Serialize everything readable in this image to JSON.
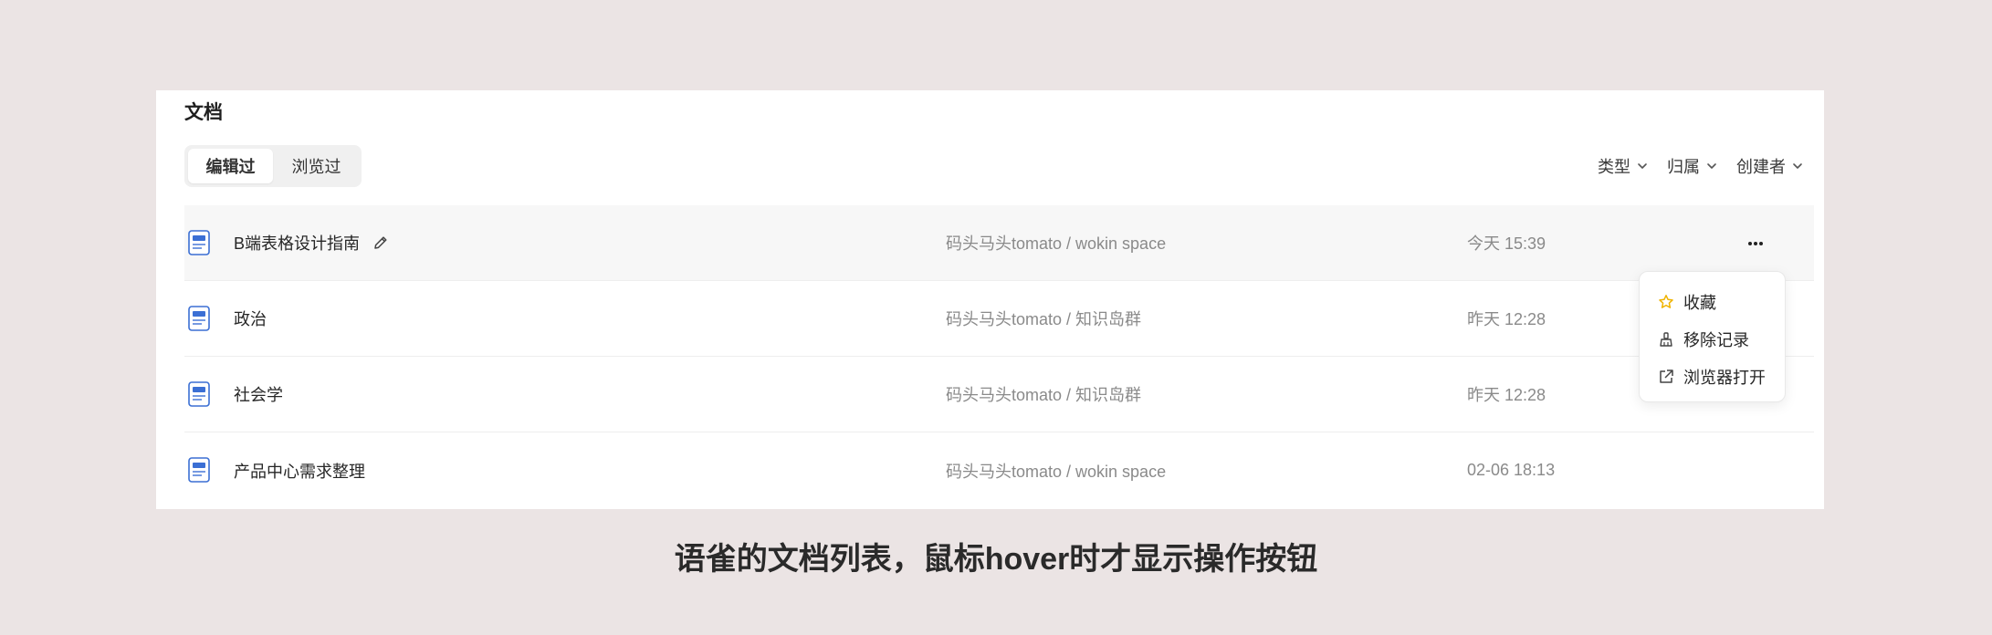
{
  "panel": {
    "title": "文档",
    "tabs": [
      {
        "label": "编辑过",
        "active": true
      },
      {
        "label": "浏览过",
        "active": false
      }
    ],
    "filters": [
      {
        "label": "类型"
      },
      {
        "label": "归属"
      },
      {
        "label": "创建者"
      }
    ]
  },
  "documents": [
    {
      "name": "B端表格设计指南",
      "belong": "码头马头tomato / wokin space",
      "time": "今天 15:39",
      "hovered": true
    },
    {
      "name": "政治",
      "belong": "码头马头tomato / 知识岛群",
      "time": "昨天 12:28"
    },
    {
      "name": "社会学",
      "belong": "码头马头tomato / 知识岛群",
      "time": "昨天 12:28"
    },
    {
      "name": "产品中心需求整理",
      "belong": "码头马头tomato / wokin space",
      "time": "02-06 18:13"
    }
  ],
  "menu": {
    "items": [
      {
        "label": "收藏",
        "icon": "star-icon"
      },
      {
        "label": "移除记录",
        "icon": "clean-icon"
      },
      {
        "label": "浏览器打开",
        "icon": "external-link-icon"
      }
    ]
  },
  "colors": {
    "background": "#ebe4e4",
    "doc_icon": "#3b6fd4",
    "star": "#f0b400"
  },
  "caption": "语雀的文档列表，鼠标hover时才显示操作按钮"
}
